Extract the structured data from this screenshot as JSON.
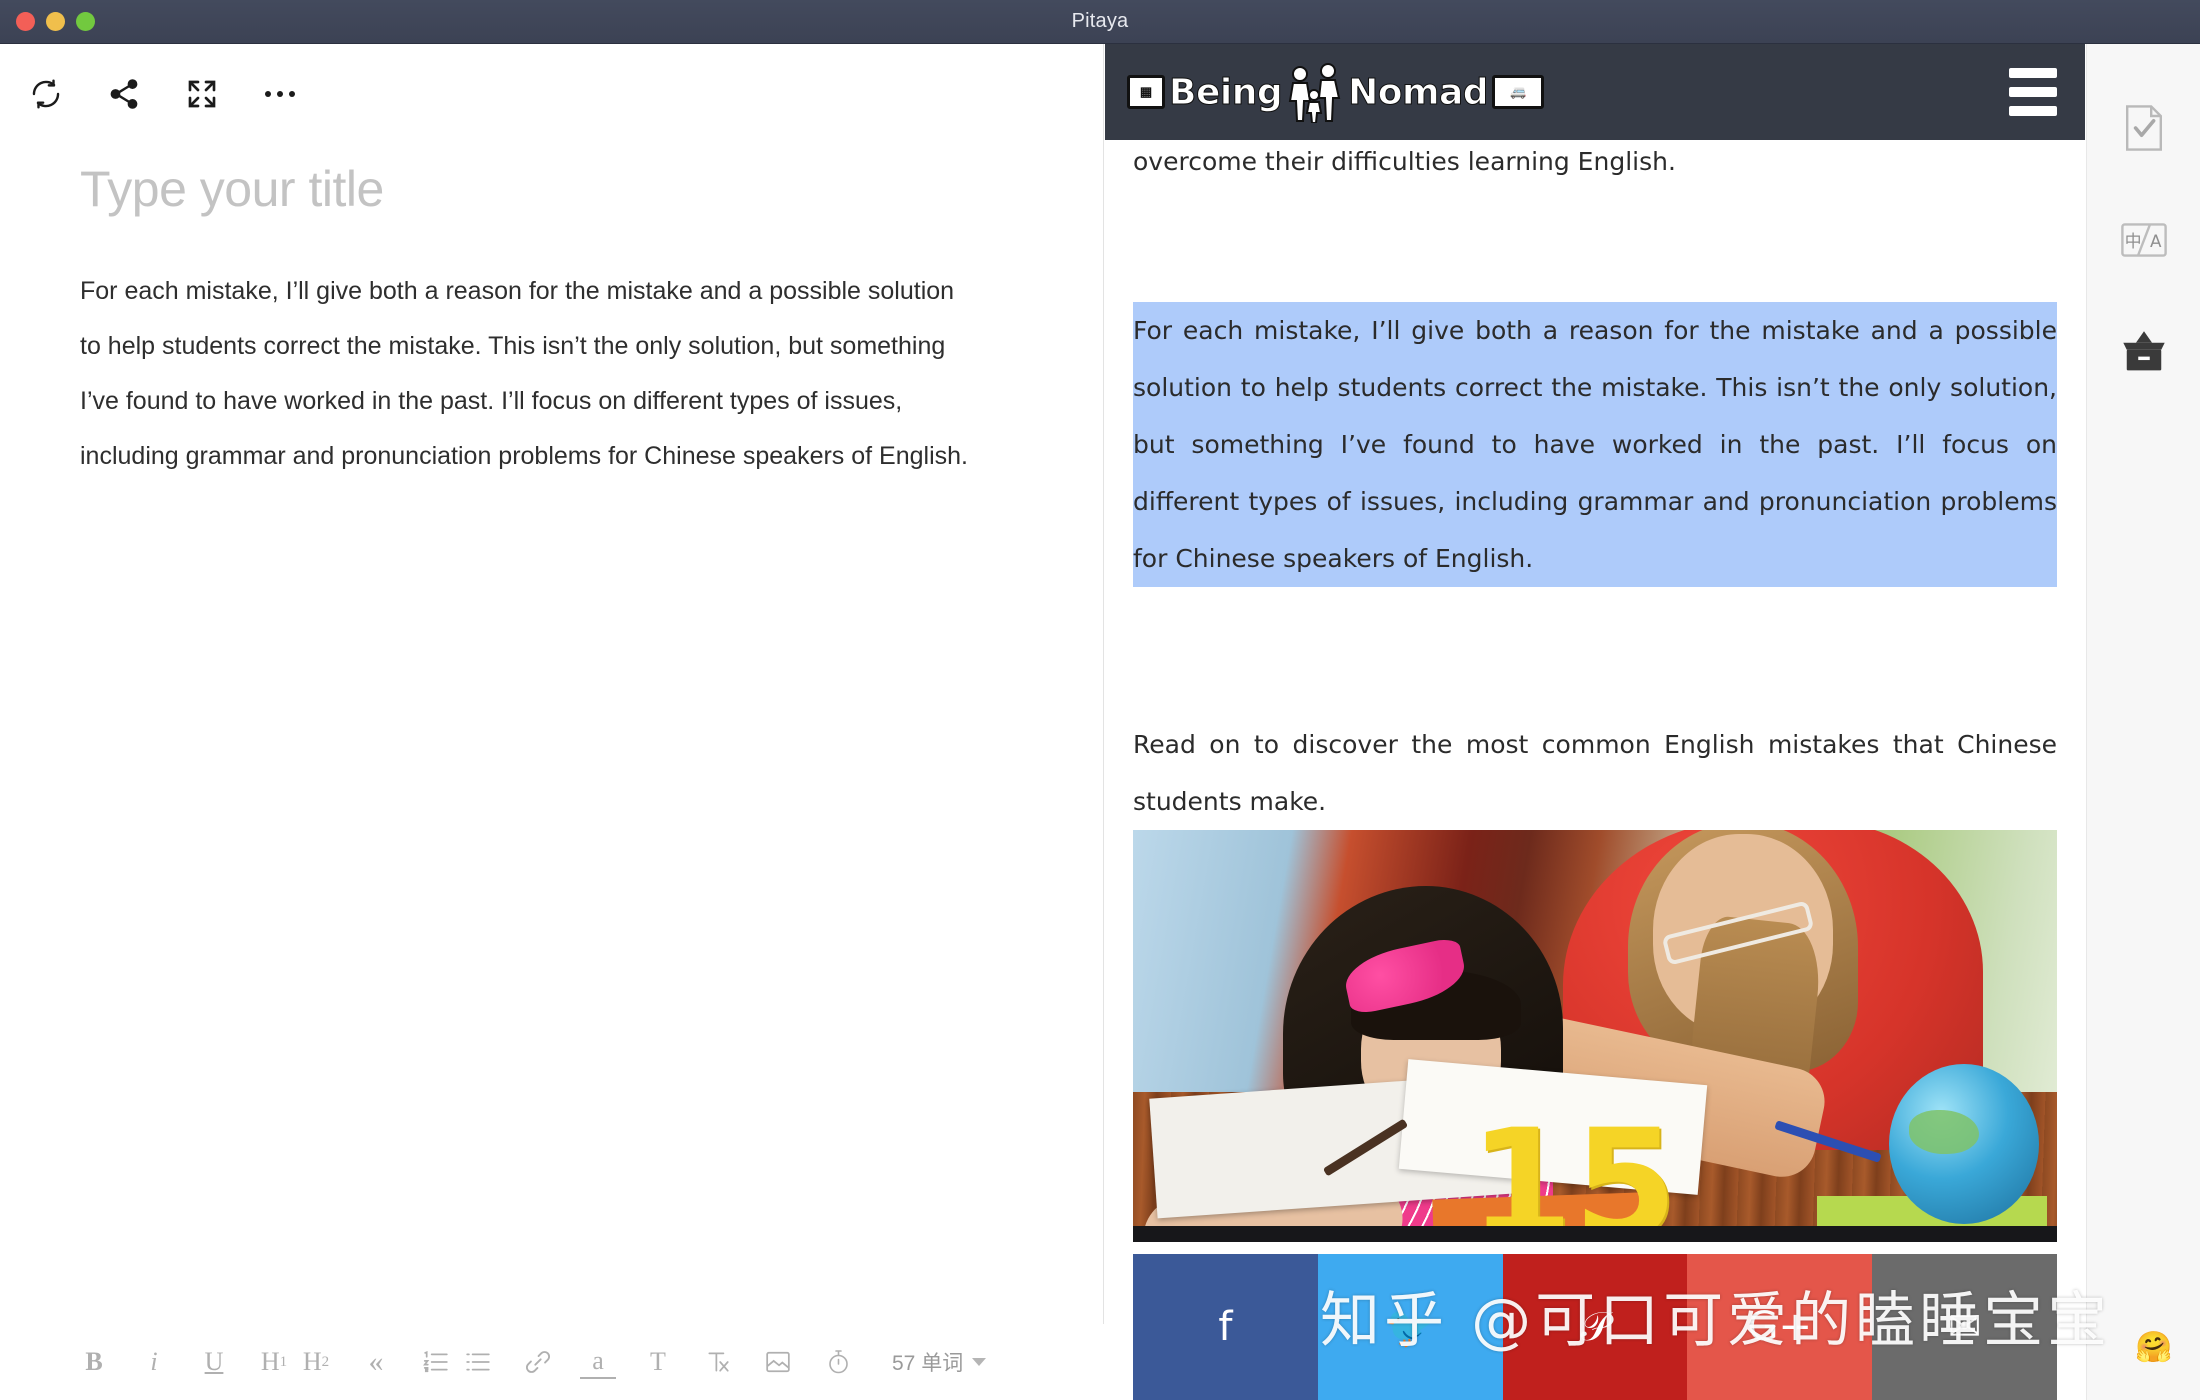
{
  "window": {
    "title": "Pitaya",
    "traffic_lights": [
      "close",
      "minimize",
      "zoom"
    ]
  },
  "editor_toolbar": {
    "buttons": [
      {
        "name": "sync-icon",
        "label": "Sync"
      },
      {
        "name": "share-icon",
        "label": "Share"
      },
      {
        "name": "fullscreen-icon",
        "label": "Fullscreen"
      },
      {
        "name": "more-icon",
        "label": "More"
      }
    ]
  },
  "document": {
    "title_placeholder": "Type your title",
    "title_value": "",
    "body": "For each mistake, I’ll give both a reason for the mistake and a possible solution to help students correct the mistake. This isn’t the only solution, but something I’ve found to have worked in the past. I’ll focus on different types of issues, including grammar and pronunciation problems for Chinese speakers of English."
  },
  "format_bar": {
    "items": [
      {
        "name": "bold-icon",
        "label": "B"
      },
      {
        "name": "italic-icon",
        "label": "i"
      },
      {
        "name": "underline-icon",
        "label": "U"
      },
      {
        "name": "heading1-icon",
        "label": "H1"
      },
      {
        "name": "heading2-icon",
        "label": "H2"
      },
      {
        "name": "blockquote-icon",
        "label": "«"
      },
      {
        "name": "ordered-list-icon",
        "label": "ordered-list"
      },
      {
        "name": "unordered-list-icon",
        "label": "unordered-list"
      },
      {
        "name": "link-icon",
        "label": "link"
      },
      {
        "name": "highlight-icon",
        "label": "a"
      },
      {
        "name": "text-style-icon",
        "label": "T"
      },
      {
        "name": "clear-format-icon",
        "label": "T×"
      },
      {
        "name": "insert-image-icon",
        "label": "image"
      },
      {
        "name": "timer-icon",
        "label": "timer"
      }
    ],
    "word_count": "57 单词"
  },
  "preview": {
    "site_header": {
      "logo_left_badge": "🖼",
      "logo_text_1": "Being",
      "logo_text_2": "Nomad",
      "menu_label": "Menu"
    },
    "paragraph_above": "…to Chinese students. But students can use it as well to help them overcome their difficulties learning English.",
    "paragraph_selected": "For each mistake, I’ll give both a reason for the mistake and a possible solution to help students correct the mistake. This isn’t the only solution, but something I’ve found to have worked in the past. I’ll focus on different types of issues, including grammar and pronunciation problems for Chinese speakers of English.",
    "paragraph_below": "Read on to discover the most common English mistakes that Chinese students make.",
    "photo_overlay_number": "15",
    "photo_alt": "Teacher helping a young girl with her homework at a desk with a globe",
    "share_buttons": [
      {
        "name": "share-facebook",
        "label": "f",
        "color": "#3b5998"
      },
      {
        "name": "share-twitter",
        "label": "🐦",
        "color": "#3eaaf0"
      },
      {
        "name": "share-pinterest",
        "label": "𝒫",
        "color": "#c0201d"
      },
      {
        "name": "share-googleplus",
        "label": "G+",
        "color": "#e4564a"
      },
      {
        "name": "share-email",
        "label": "✉",
        "color": "#6b6b6b"
      }
    ]
  },
  "rail": {
    "items": [
      {
        "name": "proofread-icon",
        "label": "Proofread"
      },
      {
        "name": "translate-icon",
        "label": "中/A"
      },
      {
        "name": "archive-icon",
        "label": "Archive"
      }
    ]
  },
  "watermark": {
    "text": "知乎 @可口可爱的瞌睡宝宝",
    "emoji": "🤗"
  },
  "colors": {
    "titlebar": "#3c4254",
    "selection": "#aecbfa",
    "site_header": "#353a45",
    "rail_bg": "#f7f7f7"
  }
}
